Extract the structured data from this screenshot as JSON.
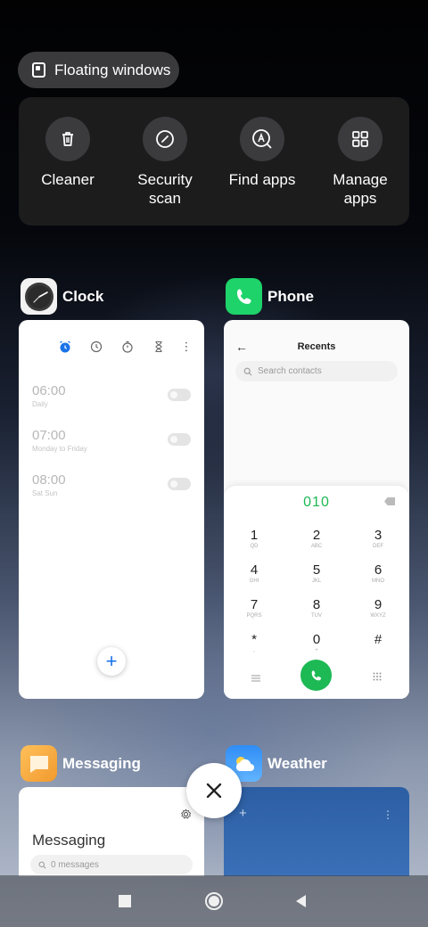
{
  "floating_windows": {
    "label": "Floating windows",
    "icon": "floating-window-icon"
  },
  "tools": [
    {
      "label": "Cleaner",
      "icon": "trash-icon"
    },
    {
      "label": "Security\nscan",
      "line1": "Security",
      "line2": "scan",
      "icon": "shield-scan-icon"
    },
    {
      "label": "Find apps",
      "icon": "find-apps-icon"
    },
    {
      "label": "Manage\napps",
      "line1": "Manage",
      "line2": "apps",
      "icon": "grid-icon"
    }
  ],
  "apps": {
    "clock": {
      "name": "Clock",
      "alarms": [
        {
          "time": "06:00",
          "repeat": "Daily"
        },
        {
          "time": "07:00",
          "repeat": "Monday to Friday"
        },
        {
          "time": "08:00",
          "repeat": "Sat Sun"
        }
      ],
      "fab": "+"
    },
    "phone": {
      "name": "Phone",
      "title": "Recents",
      "search_placeholder": "Search contacts",
      "dialed": "010",
      "keys": [
        {
          "d": "1",
          "l": "QD"
        },
        {
          "d": "2",
          "l": "ABC"
        },
        {
          "d": "3",
          "l": "DEF"
        },
        {
          "d": "4",
          "l": "GHI"
        },
        {
          "d": "5",
          "l": "JKL"
        },
        {
          "d": "6",
          "l": "MNO"
        },
        {
          "d": "7",
          "l": "PQRS"
        },
        {
          "d": "8",
          "l": "TUV"
        },
        {
          "d": "9",
          "l": "WXYZ"
        },
        {
          "d": "*",
          "l": ","
        },
        {
          "d": "0",
          "l": "+"
        },
        {
          "d": "#",
          "l": ""
        }
      ]
    },
    "messaging": {
      "name": "Messaging",
      "title": "Messaging",
      "search_placeholder": "0 messages"
    },
    "weather": {
      "name": "Weather",
      "add": "+",
      "menu": "⋮"
    }
  },
  "colors": {
    "phone_green": "#1db954",
    "accent_blue": "#1a73e8",
    "weather_blue": "#2f64a8",
    "messaging_orange": "#f6a53a"
  },
  "clock_toolbar_menu": "⋮"
}
